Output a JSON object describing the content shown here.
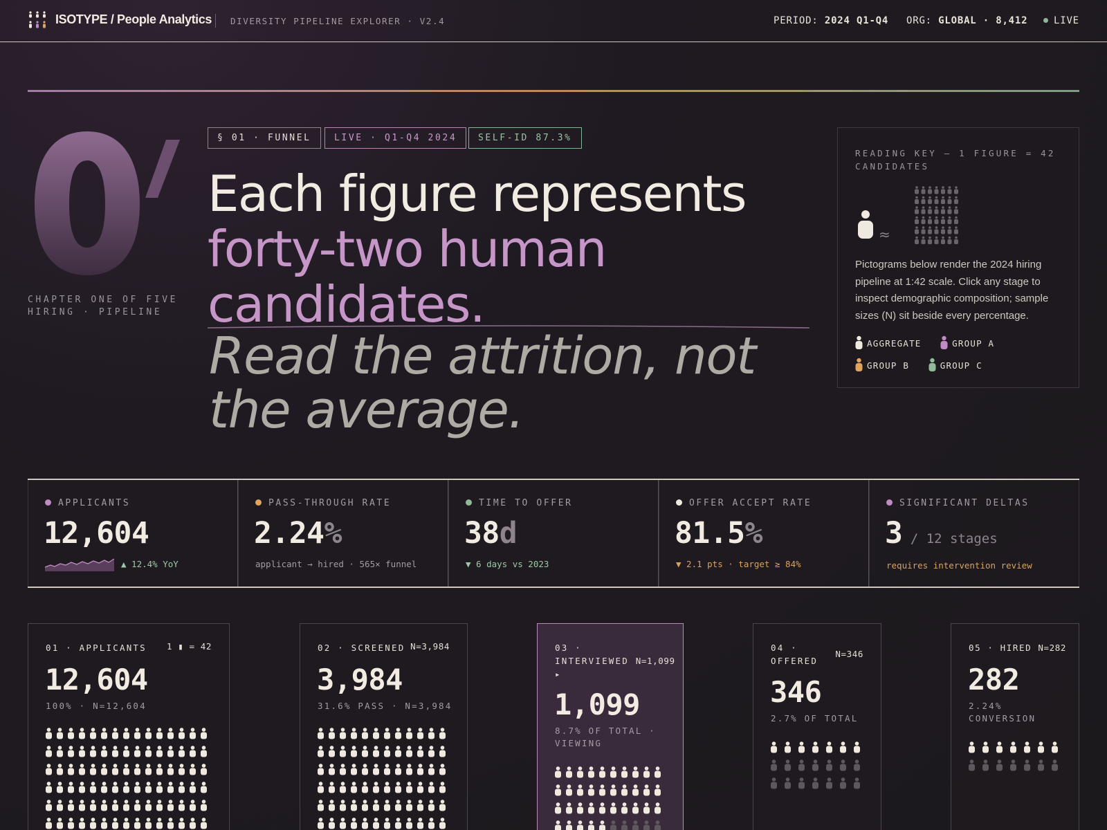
{
  "topbar": {
    "brand": "ISOTYPE / People Analytics",
    "subtitle": "DIVERSITY PIPELINE EXPLORER · V2.4",
    "period_label": "PERIOD:",
    "period_value": "2024 Q1-Q4",
    "org_label": "ORG:",
    "org_value": "GLOBAL · 8,412",
    "live": "LIVE"
  },
  "hero": {
    "chapter_line1": "CHAPTER ONE OF FIVE",
    "chapter_line2": "HIRING · PIPELINE",
    "tags": [
      "§ 01 · FUNNEL",
      "LIVE · Q1-Q4 2024",
      "SELF-ID 87.3%"
    ],
    "headline_1": "Each figure represents",
    "headline_2": "forty-two human",
    "headline_3": "candidates.",
    "italic_1": "Read the attrition, not",
    "italic_2": "the average."
  },
  "reading_key": {
    "title": "READING KEY — 1 FIGURE = 42 CANDIDATES",
    "description": "Pictograms below render the 2024 hiring pipeline at 1:42 scale. Click any stage to inspect demographic composition; sample sizes (N) sit beside every percentage.",
    "legend": [
      {
        "label": "AGGREGATE",
        "color": "#efe9df"
      },
      {
        "label": "GROUP A",
        "color": "#c08ac5"
      },
      {
        "label": "GROUP B",
        "color": "#e0a45c"
      },
      {
        "label": "GROUP C",
        "color": "#8fba98"
      }
    ]
  },
  "stats": [
    {
      "label": "APPLICANTS",
      "dot": "#c08ac5",
      "value": "12,604",
      "unit": "",
      "sub": "▲ 12.4% YoY",
      "sub_style": "green"
    },
    {
      "label": "PASS-THROUGH RATE",
      "dot": "#e0a45c",
      "value": "2.24",
      "unit": "%",
      "sub": "applicant → hired · 565× funnel",
      "sub_style": "plain"
    },
    {
      "label": "TIME TO OFFER",
      "dot": "#8fba98",
      "value": "38",
      "unit": "d",
      "sub": "▼ 6 days vs 2023",
      "sub_style": "green"
    },
    {
      "label": "OFFER ACCEPT RATE",
      "dot": "#efe9df",
      "value": "81.5",
      "unit": "%",
      "sub": "▼ 2.1 pts · target ≥ 84%",
      "sub_style": "amber"
    },
    {
      "label": "SIGNIFICANT DELTAS",
      "dot": "#c08ac5",
      "value": "3",
      "unit": " / 12 stages",
      "sub": "requires intervention review",
      "sub_style": "amber"
    }
  ],
  "stages": [
    {
      "head": "01 · APPLICANTS",
      "n": "1 ▮ = 42",
      "value": "12,604",
      "sub": "100% · N=12,604"
    },
    {
      "head": "02 · SCREENED",
      "n": "N=3,984",
      "value": "3,984",
      "sub": "31.6% PASS · N=3,984"
    },
    {
      "head_1": "03 ·",
      "head_2": "INTERVIEWED",
      "n": "N=1,099",
      "arrow": "▸",
      "value": "1,099",
      "sub_1": "8.7% OF TOTAL ·",
      "sub_2": "VIEWING"
    },
    {
      "head_1": "04 ·",
      "head_2": "OFFERED",
      "n": "N=346",
      "value": "346",
      "sub": "2.7% OF TOTAL"
    },
    {
      "head": "05 · HIRED",
      "n": "N=282",
      "value": "282",
      "sub_1": "2.24%",
      "sub_2": "CONVERSION"
    }
  ]
}
